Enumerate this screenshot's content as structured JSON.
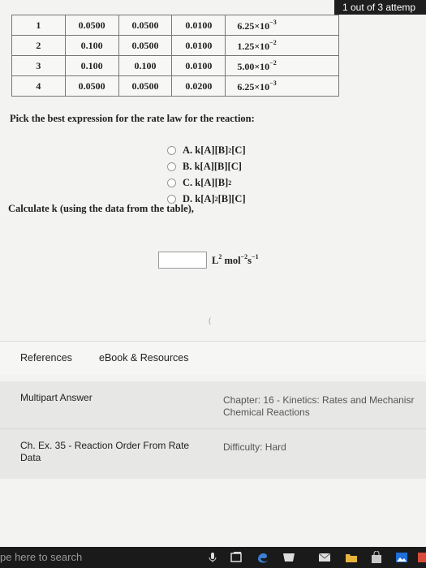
{
  "attempts": "1 out of 3 attemp",
  "table": {
    "rows": [
      {
        "exp": "1",
        "a": "0.0500",
        "b": "0.0500",
        "c": "0.0100",
        "rate": "6.25×10",
        "exp_power": "−3"
      },
      {
        "exp": "2",
        "a": "0.100",
        "b": "0.0500",
        "c": "0.0100",
        "rate": "1.25×10",
        "exp_power": "−2"
      },
      {
        "exp": "3",
        "a": "0.100",
        "b": "0.100",
        "c": "0.0100",
        "rate": "5.00×10",
        "exp_power": "−2"
      },
      {
        "exp": "4",
        "a": "0.0500",
        "b": "0.0500",
        "c": "0.0200",
        "rate": "6.25×10",
        "exp_power": "−3"
      }
    ]
  },
  "question": "Pick the best expression for the rate law for the reaction:",
  "options": [
    {
      "letter": "A.",
      "base": "k[A][B]",
      "sup": "2",
      "tail": "[C]"
    },
    {
      "letter": "B.",
      "base": "k[A][B][C]",
      "sup": "",
      "tail": ""
    },
    {
      "letter": "C.",
      "base": "k[A][B]",
      "sup": "2",
      "tail": ""
    },
    {
      "letter": "D.",
      "base": "k[A]",
      "sup": "2",
      "tail": "[B][C]"
    }
  ],
  "calc_prompt": "Calculate k (using the data from the table),",
  "answer": {
    "value": "",
    "units_html": [
      "L",
      "2",
      " mol",
      "−2",
      "s",
      "−1"
    ]
  },
  "tiny_mark": "(",
  "tabs": {
    "references": "References",
    "ebook": "eBook & Resources"
  },
  "info": {
    "multipart": "Multipart Answer",
    "chapter_line1": "Chapter: 16 - Kinetics: Rates and Mechanisr",
    "chapter_line2": "Chemical Reactions",
    "exercise_line1": "Ch. Ex. 35 - Reaction Order From Rate",
    "exercise_line2": "Data",
    "difficulty": "Difficulty: Hard"
  },
  "taskbar": {
    "search_hint": "pe here to search"
  }
}
